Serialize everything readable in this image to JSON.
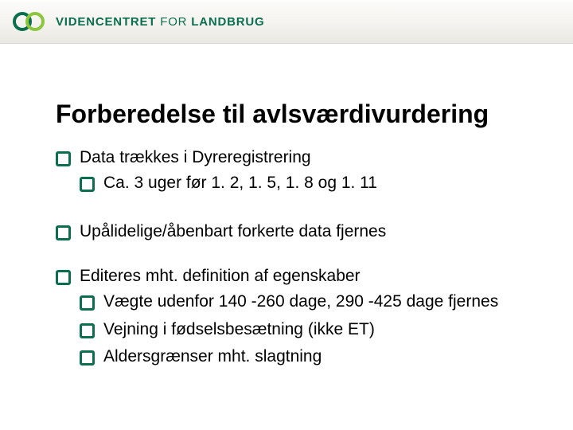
{
  "header": {
    "brand_bold1": "VIDENCENTRET",
    "brand_thin": " FOR ",
    "brand_bold2": "LANDBRUG",
    "logo_icon": "two-rings-icon"
  },
  "slide": {
    "title": "Forberedelse til avlsværdivurdering",
    "bullets": [
      {
        "text": "Data trækkes i Dyreregistrering",
        "children": [
          {
            "text": "Ca. 3 uger før 1. 2, 1. 5, 1. 8 og 1. 11"
          }
        ]
      },
      {
        "text": "Upålidelige/åbenbart forkerte data fjernes"
      },
      {
        "text": "Editeres mht. definition af egenskaber",
        "children": [
          {
            "text": "Vægte udenfor 140 -260 dage, 290 -425 dage fjernes"
          },
          {
            "text": "Vejning i fødselsbesætning (ikke ET)"
          },
          {
            "text": "Aldersgrænser mht. slagtning"
          }
        ]
      }
    ]
  },
  "colors": {
    "accent": "#0b6e4f"
  }
}
